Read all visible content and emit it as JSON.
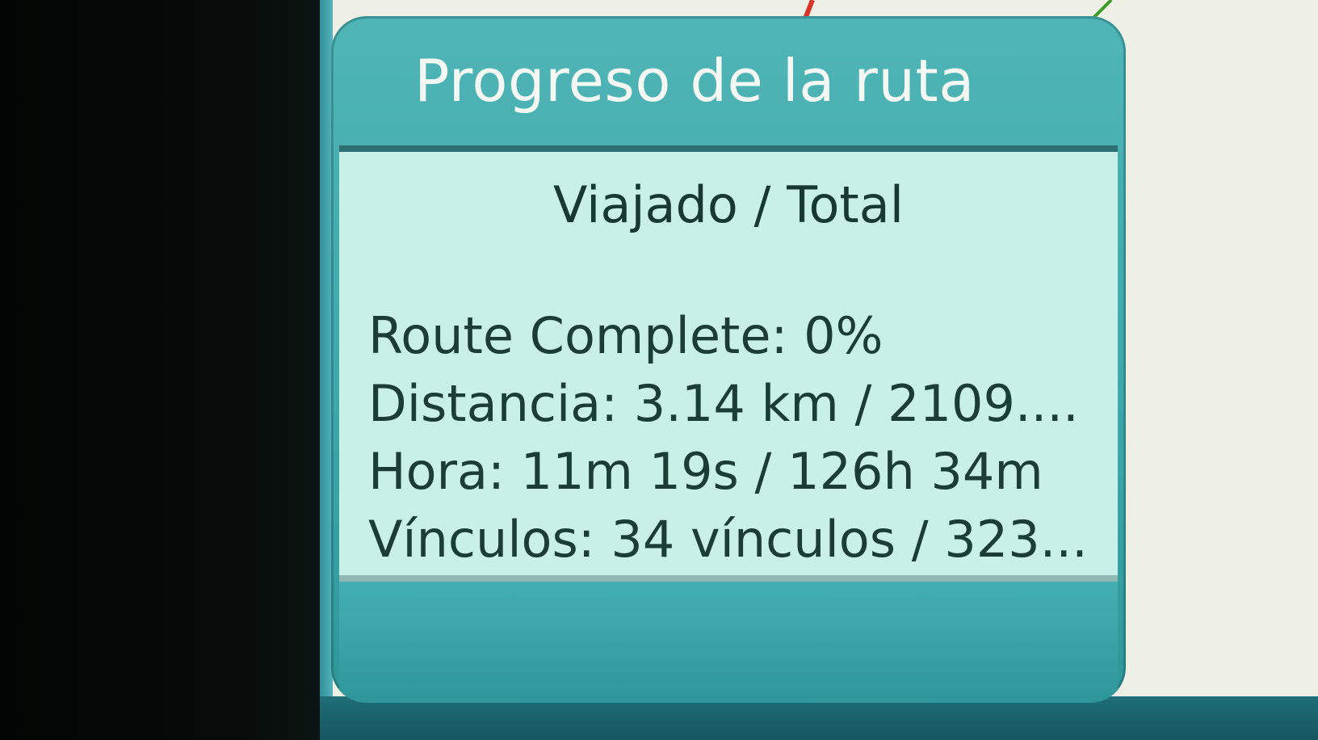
{
  "dialog": {
    "title": "Progreso de la ruta",
    "subtitle": "Viajado / Total",
    "stats": [
      "Route Complete: 0%",
      "Distancia: 3.14 km / 2109....",
      "Hora: 11m 19s / 126h 34m",
      "Vínculos: 34 vínculos / 323..."
    ]
  },
  "colors": {
    "dialog_teal": "#3ea6a9",
    "panel_bg": "#c9f0e8",
    "text_dark": "#1a3e36",
    "title_text": "#f4f8f2",
    "route_line_green": "#3a9a2a",
    "route_line_red": "#d8352a"
  }
}
